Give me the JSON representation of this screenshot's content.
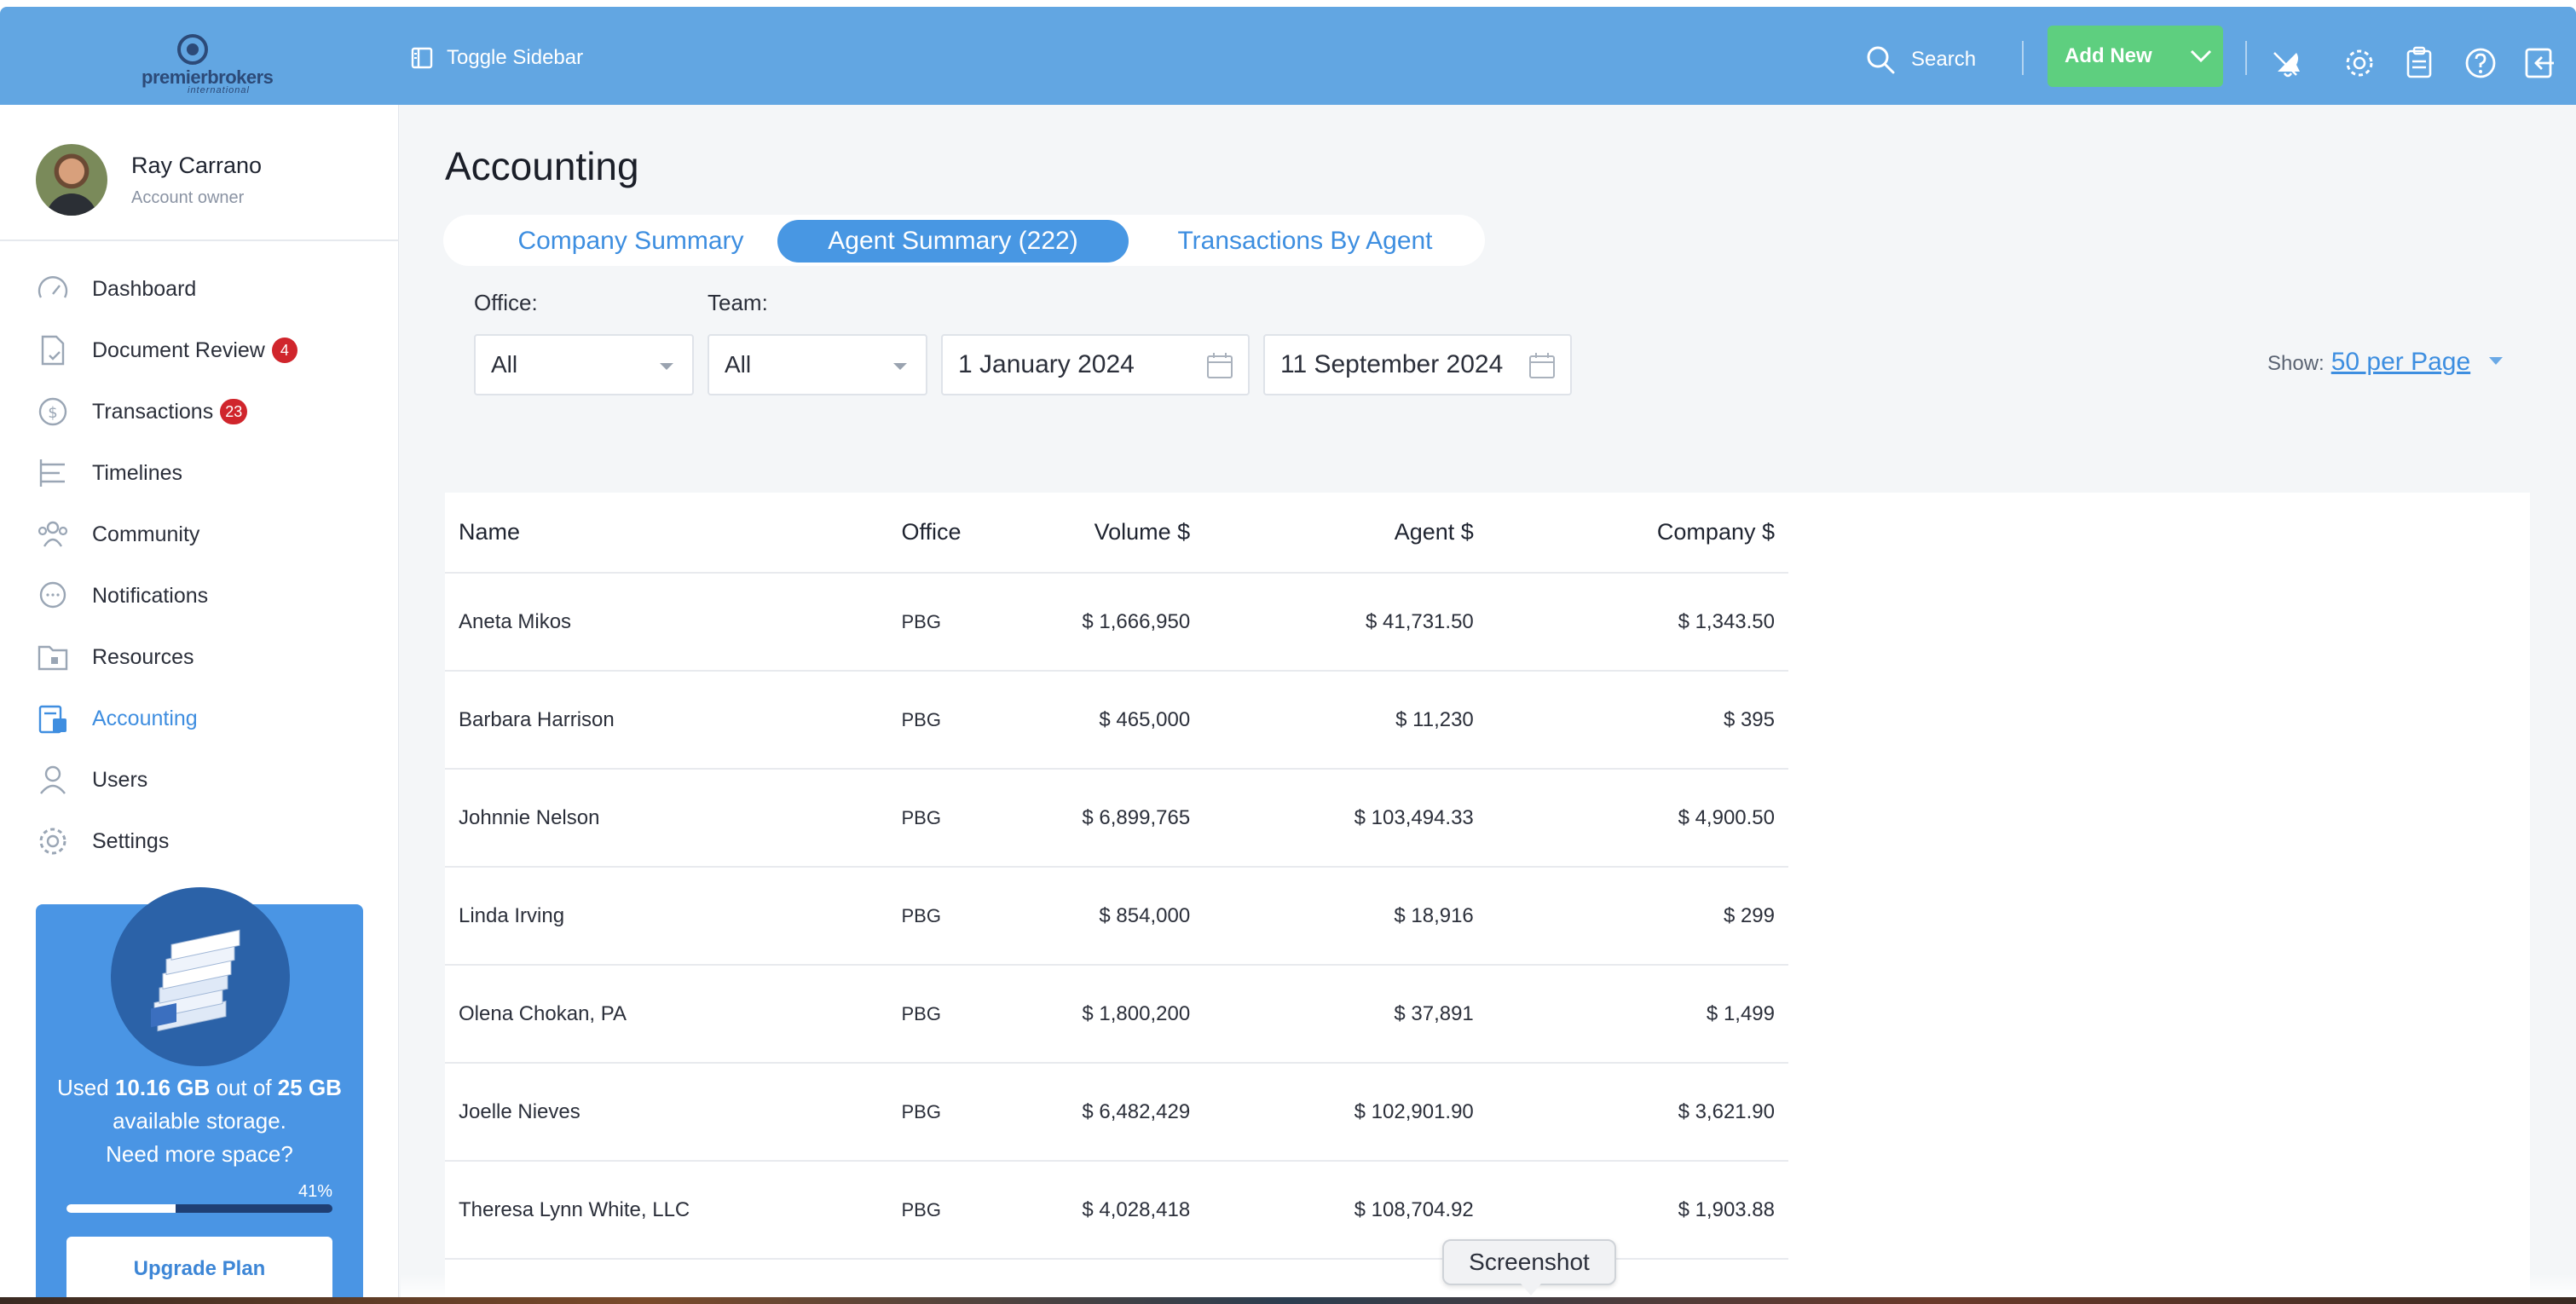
{
  "app": {
    "logo_text_main": "premierbrokers",
    "logo_text_sub": "international"
  },
  "topbar": {
    "toggle_label": "Toggle Sidebar",
    "search_label": "Search",
    "add_new_label": "Add New",
    "icons": [
      "bell-slash-icon",
      "gear-icon",
      "clipboard-icon",
      "help-icon",
      "logout-icon"
    ]
  },
  "profile": {
    "name": "Ray Carrano",
    "role": "Account owner"
  },
  "sidebar": {
    "items": [
      {
        "label": "Dashboard",
        "icon": "gauge-icon"
      },
      {
        "label": "Document Review",
        "icon": "document-check-icon",
        "badge": "4"
      },
      {
        "label": "Transactions",
        "icon": "dollar-circle-icon",
        "badge": "23"
      },
      {
        "label": "Timelines",
        "icon": "timeline-icon"
      },
      {
        "label": "Community",
        "icon": "people-icon"
      },
      {
        "label": "Notifications",
        "icon": "chat-bubble-icon"
      },
      {
        "label": "Resources",
        "icon": "folder-icon"
      },
      {
        "label": "Accounting",
        "icon": "calculator-icon",
        "active": true
      },
      {
        "label": "Users",
        "icon": "user-icon"
      },
      {
        "label": "Settings",
        "icon": "gear-icon"
      }
    ]
  },
  "storage": {
    "used": "10.16 GB",
    "total": "25 GB",
    "text_used_prefix": "Used",
    "text_out_of": "out of",
    "text_available": "available storage.",
    "text_need_more": "Need more space?",
    "percent_label": "41%",
    "percent_value": 0.41,
    "upgrade_label": "Upgrade Plan"
  },
  "main": {
    "title": "Accounting",
    "tabs": [
      {
        "label": "Company Summary",
        "active": false
      },
      {
        "label": "Agent Summary (222)",
        "active": true
      },
      {
        "label": "Transactions By Agent",
        "active": false
      }
    ],
    "filters": {
      "office_label": "Office:",
      "office_value": "All",
      "team_label": "Team:",
      "team_value": "All",
      "date_from": "1 January 2024",
      "date_to": "11 September 2024"
    },
    "show": {
      "label": "Show:",
      "value": "50 per Page"
    },
    "table": {
      "headers": [
        "Name",
        "Office",
        "Volume $",
        "Agent $",
        "Company $"
      ],
      "rows": [
        [
          "Aneta Mikos",
          "PBG",
          "$ 1,666,950",
          "$ 41,731.50",
          "$ 1,343.50"
        ],
        [
          "Barbara Harrison",
          "PBG",
          "$ 465,000",
          "$ 11,230",
          "$ 395"
        ],
        [
          "Johnnie Nelson",
          "PBG",
          "$ 6,899,765",
          "$ 103,494.33",
          "$ 4,900.50"
        ],
        [
          "Linda Irving",
          "PBG",
          "$ 854,000",
          "$ 18,916",
          "$ 299"
        ],
        [
          "Olena Chokan, PA",
          "PBG",
          "$ 1,800,200",
          "$ 37,891",
          "$ 1,499"
        ],
        [
          "Joelle Nieves",
          "PBG",
          "$ 6,482,429",
          "$ 102,901.90",
          "$ 3,621.90"
        ],
        [
          "Theresa Lynn White, LLC",
          "PBG",
          "$ 4,028,418",
          "$ 108,704.92",
          "$ 1,903.88"
        ]
      ]
    }
  },
  "tooltip": {
    "text": "Screenshot"
  },
  "colors": {
    "topbar": "#62a6e2",
    "accent": "#4897e3",
    "add_new": "#5ecf7f",
    "badge": "#d0252c",
    "storage_card": "#4a95e4"
  }
}
